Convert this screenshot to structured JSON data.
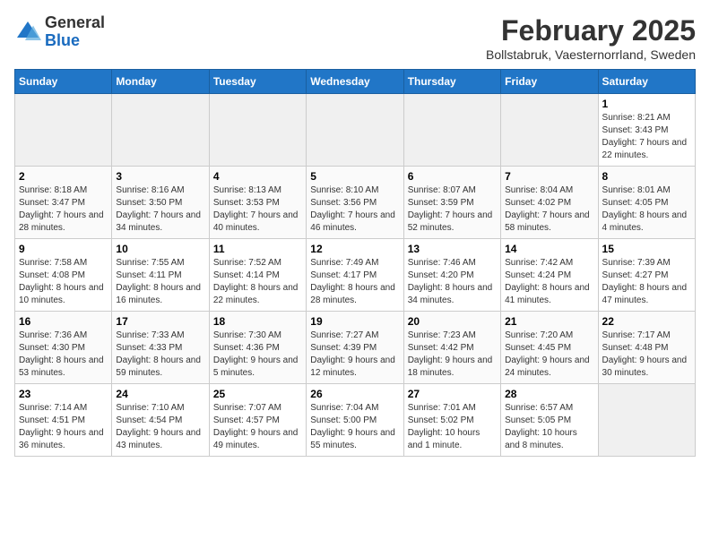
{
  "logo": {
    "general": "General",
    "blue": "Blue"
  },
  "title": "February 2025",
  "subtitle": "Bollstabruk, Vaesternorrland, Sweden",
  "weekdays": [
    "Sunday",
    "Monday",
    "Tuesday",
    "Wednesday",
    "Thursday",
    "Friday",
    "Saturday"
  ],
  "weeks": [
    [
      {
        "day": "",
        "info": ""
      },
      {
        "day": "",
        "info": ""
      },
      {
        "day": "",
        "info": ""
      },
      {
        "day": "",
        "info": ""
      },
      {
        "day": "",
        "info": ""
      },
      {
        "day": "",
        "info": ""
      },
      {
        "day": "1",
        "info": "Sunrise: 8:21 AM\nSunset: 3:43 PM\nDaylight: 7 hours and 22 minutes."
      }
    ],
    [
      {
        "day": "2",
        "info": "Sunrise: 8:18 AM\nSunset: 3:47 PM\nDaylight: 7 hours and 28 minutes."
      },
      {
        "day": "3",
        "info": "Sunrise: 8:16 AM\nSunset: 3:50 PM\nDaylight: 7 hours and 34 minutes."
      },
      {
        "day": "4",
        "info": "Sunrise: 8:13 AM\nSunset: 3:53 PM\nDaylight: 7 hours and 40 minutes."
      },
      {
        "day": "5",
        "info": "Sunrise: 8:10 AM\nSunset: 3:56 PM\nDaylight: 7 hours and 46 minutes."
      },
      {
        "day": "6",
        "info": "Sunrise: 8:07 AM\nSunset: 3:59 PM\nDaylight: 7 hours and 52 minutes."
      },
      {
        "day": "7",
        "info": "Sunrise: 8:04 AM\nSunset: 4:02 PM\nDaylight: 7 hours and 58 minutes."
      },
      {
        "day": "8",
        "info": "Sunrise: 8:01 AM\nSunset: 4:05 PM\nDaylight: 8 hours and 4 minutes."
      }
    ],
    [
      {
        "day": "9",
        "info": "Sunrise: 7:58 AM\nSunset: 4:08 PM\nDaylight: 8 hours and 10 minutes."
      },
      {
        "day": "10",
        "info": "Sunrise: 7:55 AM\nSunset: 4:11 PM\nDaylight: 8 hours and 16 minutes."
      },
      {
        "day": "11",
        "info": "Sunrise: 7:52 AM\nSunset: 4:14 PM\nDaylight: 8 hours and 22 minutes."
      },
      {
        "day": "12",
        "info": "Sunrise: 7:49 AM\nSunset: 4:17 PM\nDaylight: 8 hours and 28 minutes."
      },
      {
        "day": "13",
        "info": "Sunrise: 7:46 AM\nSunset: 4:20 PM\nDaylight: 8 hours and 34 minutes."
      },
      {
        "day": "14",
        "info": "Sunrise: 7:42 AM\nSunset: 4:24 PM\nDaylight: 8 hours and 41 minutes."
      },
      {
        "day": "15",
        "info": "Sunrise: 7:39 AM\nSunset: 4:27 PM\nDaylight: 8 hours and 47 minutes."
      }
    ],
    [
      {
        "day": "16",
        "info": "Sunrise: 7:36 AM\nSunset: 4:30 PM\nDaylight: 8 hours and 53 minutes."
      },
      {
        "day": "17",
        "info": "Sunrise: 7:33 AM\nSunset: 4:33 PM\nDaylight: 8 hours and 59 minutes."
      },
      {
        "day": "18",
        "info": "Sunrise: 7:30 AM\nSunset: 4:36 PM\nDaylight: 9 hours and 5 minutes."
      },
      {
        "day": "19",
        "info": "Sunrise: 7:27 AM\nSunset: 4:39 PM\nDaylight: 9 hours and 12 minutes."
      },
      {
        "day": "20",
        "info": "Sunrise: 7:23 AM\nSunset: 4:42 PM\nDaylight: 9 hours and 18 minutes."
      },
      {
        "day": "21",
        "info": "Sunrise: 7:20 AM\nSunset: 4:45 PM\nDaylight: 9 hours and 24 minutes."
      },
      {
        "day": "22",
        "info": "Sunrise: 7:17 AM\nSunset: 4:48 PM\nDaylight: 9 hours and 30 minutes."
      }
    ],
    [
      {
        "day": "23",
        "info": "Sunrise: 7:14 AM\nSunset: 4:51 PM\nDaylight: 9 hours and 36 minutes."
      },
      {
        "day": "24",
        "info": "Sunrise: 7:10 AM\nSunset: 4:54 PM\nDaylight: 9 hours and 43 minutes."
      },
      {
        "day": "25",
        "info": "Sunrise: 7:07 AM\nSunset: 4:57 PM\nDaylight: 9 hours and 49 minutes."
      },
      {
        "day": "26",
        "info": "Sunrise: 7:04 AM\nSunset: 5:00 PM\nDaylight: 9 hours and 55 minutes."
      },
      {
        "day": "27",
        "info": "Sunrise: 7:01 AM\nSunset: 5:02 PM\nDaylight: 10 hours and 1 minute."
      },
      {
        "day": "28",
        "info": "Sunrise: 6:57 AM\nSunset: 5:05 PM\nDaylight: 10 hours and 8 minutes."
      },
      {
        "day": "",
        "info": ""
      }
    ]
  ]
}
